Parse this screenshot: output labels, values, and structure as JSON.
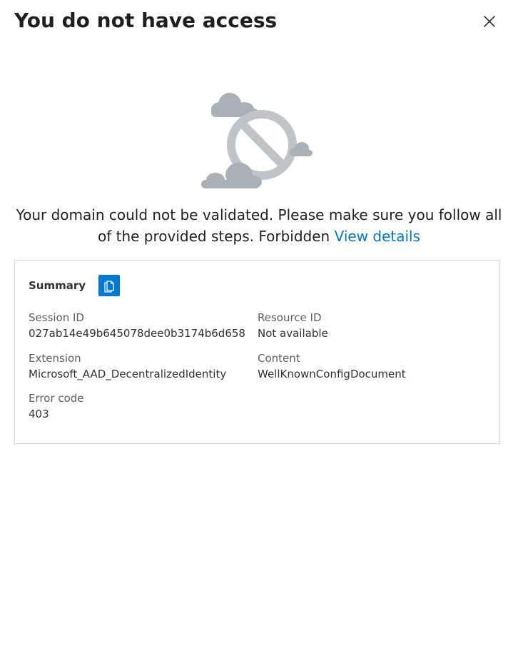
{
  "header": {
    "title": "You do not have access",
    "close_icon": "close-icon"
  },
  "illustration": {
    "icon": "no-access-cloud-icon",
    "colors": {
      "cloud": "#aab0b8",
      "sign": "#c0c4c9"
    }
  },
  "message": {
    "text": "Your domain could not be validated. Please make sure you follow all of the provided steps. Forbidden",
    "link_label": "View details",
    "link_color": "#0078d4"
  },
  "summary": {
    "title": "Summary",
    "copy_icon": "copy-icon",
    "accent_color": "#0078d4",
    "fields": {
      "session_id": {
        "label": "Session ID",
        "value": "027ab14e49b645078dee0b3174b6d658"
      },
      "resource_id": {
        "label": "Resource ID",
        "value": "Not available"
      },
      "extension": {
        "label": "Extension",
        "value": "Microsoft_AAD_DecentralizedIdentity"
      },
      "content": {
        "label": "Content",
        "value": "WellKnownConfigDocument"
      },
      "error_code": {
        "label": "Error code",
        "value": "403"
      }
    }
  }
}
